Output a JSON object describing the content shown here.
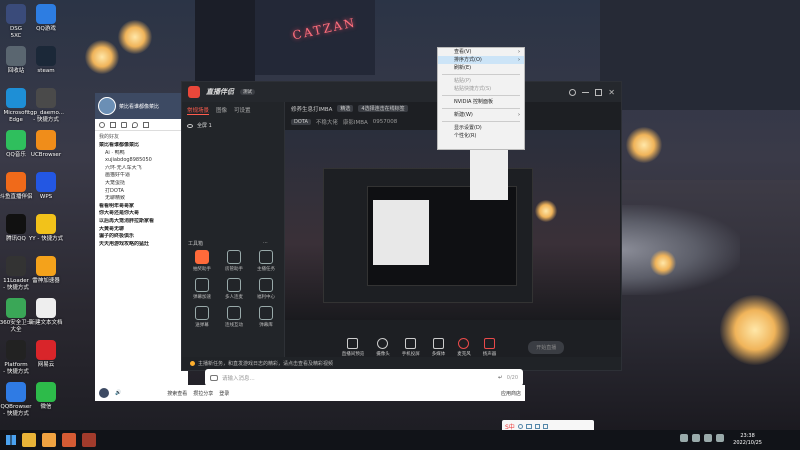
{
  "desktop_icons": [
    {
      "label": "DSG\n5XC",
      "color": "#3a4b7a"
    },
    {
      "label": "QQ游戏",
      "color": "#2d7de2"
    },
    {
      "label": "回收站",
      "color": "#5a6670"
    },
    {
      "label": "steam",
      "color": "#1b2838"
    },
    {
      "label": "Microsoft\nEdge",
      "color": "#1e8fd6"
    },
    {
      "label": "tgp_daemo...\n- 快捷方式",
      "color": "#4a4a4a"
    },
    {
      "label": "QQ音乐",
      "color": "#2fbf5d"
    },
    {
      "label": "UCBrowser",
      "color": "#f08d1a"
    },
    {
      "label": "斗鱼直播伴侣",
      "color": "#f06a1a"
    },
    {
      "label": "WPS",
      "color": "#2357e3"
    },
    {
      "label": "腾讯QQ",
      "color": "#111"
    },
    {
      "label": "YY - 快捷方式",
      "color": "#f2c21a"
    },
    {
      "label": "11Loader\n- 快捷方式",
      "color": "#333"
    },
    {
      "label": "雷神加速器",
      "color": "#f4a21b"
    },
    {
      "label": "360安全卫士\n大全",
      "color": "#3aa757"
    },
    {
      "label": "新建文本文档",
      "color": "#eee"
    },
    {
      "label": "Platform\n- 快捷方式",
      "color": "#222"
    },
    {
      "label": "网易云",
      "color": "#d9252a"
    },
    {
      "label": "QQBrowser\n- 快捷方式",
      "color": "#2f7be4"
    },
    {
      "label": "微信",
      "color": "#2dbb4a"
    }
  ],
  "scene": {
    "neon_sign": "CATZAN"
  },
  "left_window": {
    "username": "菜比看谁都像菜比",
    "section": "我的好友",
    "group_header": "菜比看谁都像菜比",
    "items": [
      {
        "label": "菜比看谁都像菜比",
        "kind": "grp"
      },
      {
        "label": "Ai ·  鸭鸭",
        "kind": "sub"
      },
      {
        "label": "xujiabdog8985050",
        "kind": "sub"
      },
      {
        "label": "六环·无人车大飞",
        "kind": "sub"
      },
      {
        "label": "画猫好牛逼",
        "kind": "sub"
      },
      {
        "label": "大笼蛋挞",
        "kind": "sub"
      },
      {
        "label": "打DOTA",
        "kind": "sub"
      },
      {
        "label": "无聊精致",
        "kind": "sub"
      },
      {
        "label": "看看明年哥哥家",
        "kind": "grp"
      },
      {
        "label": "你大哥还是你大哥",
        "kind": "grp"
      },
      {
        "label": "以后再大笼消胖拉斯家看",
        "kind": "grp"
      },
      {
        "label": "大黄哥无聊",
        "kind": "grp"
      },
      {
        "label": "骗子的终极俱乐",
        "kind": "grp"
      },
      {
        "label": "天天用游戏攻略的猛灶",
        "kind": "grp"
      }
    ]
  },
  "main_window": {
    "app_name": "直播伴侣",
    "app_badge": "测试",
    "side_tabs": [
      "常规场景",
      "图像",
      "可设置"
    ],
    "scene_label": "全屏 1",
    "tools_label": "工具箱",
    "tools": [
      {
        "label": "抽奖助手",
        "hot": true
      },
      {
        "label": "房管助手",
        "hot": false
      },
      {
        "label": "主播任务",
        "hot": false
      },
      {
        "label": "弹幕加速",
        "hot": false
      },
      {
        "label": "多人连麦",
        "hot": false
      },
      {
        "label": "福利中心",
        "hot": false
      },
      {
        "label": "送弹幕",
        "hot": false
      },
      {
        "label": "连线互动",
        "hot": false
      },
      {
        "label": "弹幕库",
        "hot": false
      }
    ],
    "stream_title": "修养生息打IMBA",
    "stream_tags": [
      "精选",
      "4选择连击在线标签"
    ],
    "stream_meta": [
      "DOTA",
      "不稳大佬",
      "康影IMBA",
      "0957008"
    ],
    "controls": [
      "直播间预览",
      "摄像头",
      "手机投屏",
      "多媒体",
      "麦克风",
      "扬声器"
    ],
    "start_label": "开始直播",
    "notice_text": "主播新任务，和直发游戏日志的精彩，请点击查看及精彩视频"
  },
  "context_menu": {
    "items": [
      {
        "label": "查看(V)",
        "sub": true,
        "disabled": false
      },
      {
        "label": "排序方式(O)",
        "sub": true,
        "disabled": false,
        "highlight": true
      },
      {
        "label": "刷新(E)",
        "sub": false,
        "disabled": false
      },
      {
        "sep": true
      },
      {
        "label": "粘贴(P)",
        "sub": false,
        "disabled": true
      },
      {
        "label": "粘贴快捷方式(S)",
        "sub": false,
        "disabled": true
      },
      {
        "sep": true
      },
      {
        "label": "NVIDIA 控制面板",
        "sub": false,
        "disabled": false
      },
      {
        "sep": true
      },
      {
        "label": "新建(W)",
        "sub": true,
        "disabled": false
      },
      {
        "sep": true
      },
      {
        "label": "显示设置(D)",
        "sub": false,
        "disabled": false
      },
      {
        "label": "个性化(R)",
        "sub": false,
        "disabled": false
      }
    ]
  },
  "chat_bar": {
    "placeholder": "请输入消息...",
    "counter": "0/20"
  },
  "left_bottom": {
    "search": "搜索查看",
    "links": [
      "攒拉分享",
      "登录"
    ],
    "app_label": "应用商店"
  },
  "taskbar": {
    "time": "23:38",
    "date": "2022/10/25"
  },
  "ime": {
    "label": "S中"
  }
}
